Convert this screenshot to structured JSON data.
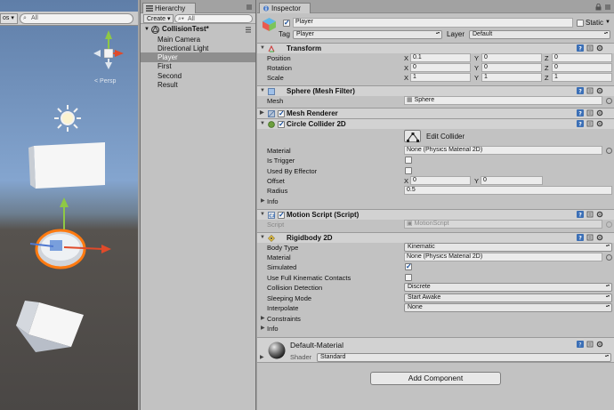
{
  "scene": {
    "dropdown_partial": "os",
    "search_placeholder": "All",
    "persp_label": "Persp"
  },
  "hierarchy": {
    "tab_label": "Hierarchy",
    "create_label": "Create",
    "search_placeholder": "All",
    "scene_name": "CollisionTest*",
    "items": [
      "Main Camera",
      "Directional Light",
      "Player",
      "First",
      "Second",
      "Result"
    ],
    "selected": "Player"
  },
  "inspector": {
    "tab_label": "Inspector",
    "object_name": "Player",
    "static_label": "Static",
    "tag_label": "Tag",
    "tag_value": "Player",
    "layer_label": "Layer",
    "layer_value": "Default",
    "transform": {
      "title": "Transform",
      "position_label": "Position",
      "rotation_label": "Rotation",
      "scale_label": "Scale",
      "position": {
        "x": "0.1",
        "y": "0",
        "z": "0"
      },
      "rotation": {
        "x": "0",
        "y": "0",
        "z": "0"
      },
      "scale": {
        "x": "1",
        "y": "1",
        "z": "1"
      }
    },
    "mesh_filter": {
      "title": "Sphere (Mesh Filter)",
      "mesh_label": "Mesh",
      "mesh_value": "Sphere"
    },
    "mesh_renderer": {
      "title": "Mesh Renderer"
    },
    "circle_collider": {
      "title": "Circle Collider 2D",
      "edit_label": "Edit Collider",
      "material_label": "Material",
      "material_value": "None (Physics Material 2D)",
      "is_trigger_label": "Is Trigger",
      "used_by_effector_label": "Used By Effector",
      "offset_label": "Offset",
      "offset": {
        "x": "0",
        "y": "0"
      },
      "radius_label": "Radius",
      "radius_value": "0.5",
      "info_label": "Info"
    },
    "motion_script": {
      "title": "Motion Script (Script)",
      "script_label": "Script",
      "script_value": "MotionScript"
    },
    "rigidbody": {
      "title": "Rigidbody 2D",
      "body_type_label": "Body Type",
      "body_type_value": "Kinematic",
      "material_label": "Material",
      "material_value": "None (Physics Material 2D)",
      "simulated_label": "Simulated",
      "full_kinematic_label": "Use Full Kinematic Contacts",
      "collision_detection_label": "Collision Detection",
      "collision_detection_value": "Discrete",
      "sleeping_mode_label": "Sleeping Mode",
      "sleeping_mode_value": "Start Awake",
      "interpolate_label": "Interpolate",
      "interpolate_value": "None",
      "constraints_label": "Constraints",
      "info_label": "Info"
    },
    "material": {
      "name": "Default-Material",
      "shader_label": "Shader",
      "shader_value": "Standard"
    },
    "add_component_label": "Add Component"
  }
}
